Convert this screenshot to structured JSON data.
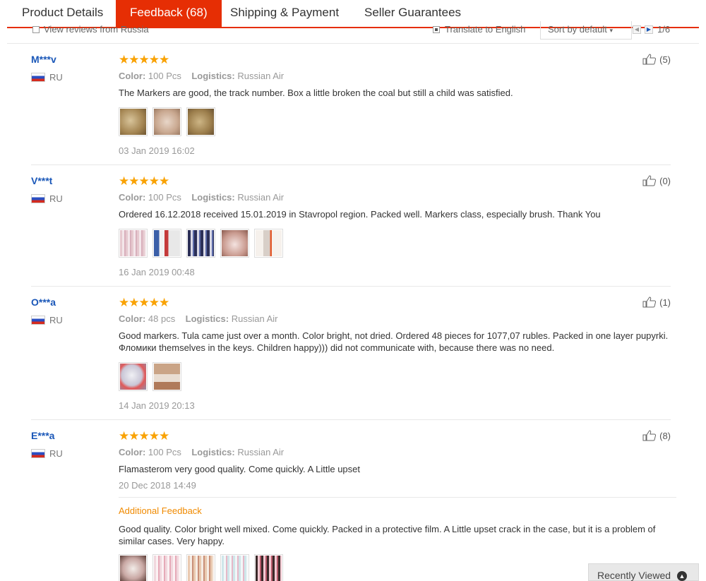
{
  "tabs": [
    {
      "label": "Product Details"
    },
    {
      "label": "Feedback (68)"
    },
    {
      "label": "Shipping & Payment"
    },
    {
      "label": "Seller Guarantees"
    }
  ],
  "filter": {
    "russia_label": "View reviews from Russia",
    "translate_label": "Translate to English",
    "sort_label": "Sort by default",
    "page_text": "1/6"
  },
  "labels": {
    "color": "Color:",
    "logistics": "Logistics:",
    "additional_feedback": "Additional Feedback"
  },
  "reviews": [
    {
      "user": "M***v",
      "country": "RU",
      "stars": "★★★★★",
      "color": "100 Pcs",
      "logistics": "Russian Air",
      "text": "The Markers are good, the track number. Box a little broken the coal but still a child was satisfied.",
      "date": "03 Jan 2019 16:02",
      "helpful": "(5)"
    },
    {
      "user": "V***t",
      "country": "RU",
      "stars": "★★★★★",
      "color": "100 Pcs",
      "logistics": "Russian Air",
      "text": "Ordered 16.12.2018 received 15.01.2019 in Stavropol region. Packed well. Markers class, especially brush. Thank You",
      "date": "16 Jan 2019 00:48",
      "helpful": "(0)"
    },
    {
      "user": "O***a",
      "country": "RU",
      "stars": "★★★★★",
      "color": "48 pcs",
      "logistics": "Russian Air",
      "text": "Good markers. Tula came just over a month. Color bright, not dried. Ordered 48 pieces for 1077,07 rubles. Packed in one layer pupyrki. Фломики themselves in the keys. Children happy))) did not communicate with, because there was no need.",
      "date": "14 Jan 2019 20:13",
      "helpful": "(1)"
    },
    {
      "user": "E***a",
      "country": "RU",
      "stars": "★★★★★",
      "color": "100 Pcs",
      "logistics": "Russian Air",
      "text": "Flamasterom very good quality. Come quickly. A Little upset",
      "date": "20 Dec 2018 14:49",
      "helpful": "(8)",
      "additional_text": "Good quality. Color bright well mixed. Come quickly. Packed in a protective film. A Little upset crack in the case, but it is a problem of similar cases. Very happy."
    }
  ],
  "recently_viewed": "Recently Viewed",
  "colors": {
    "accent": "#e62e04",
    "star": "#f9a203",
    "user_link": "#1a57b8",
    "additional_title": "#f08a00"
  }
}
